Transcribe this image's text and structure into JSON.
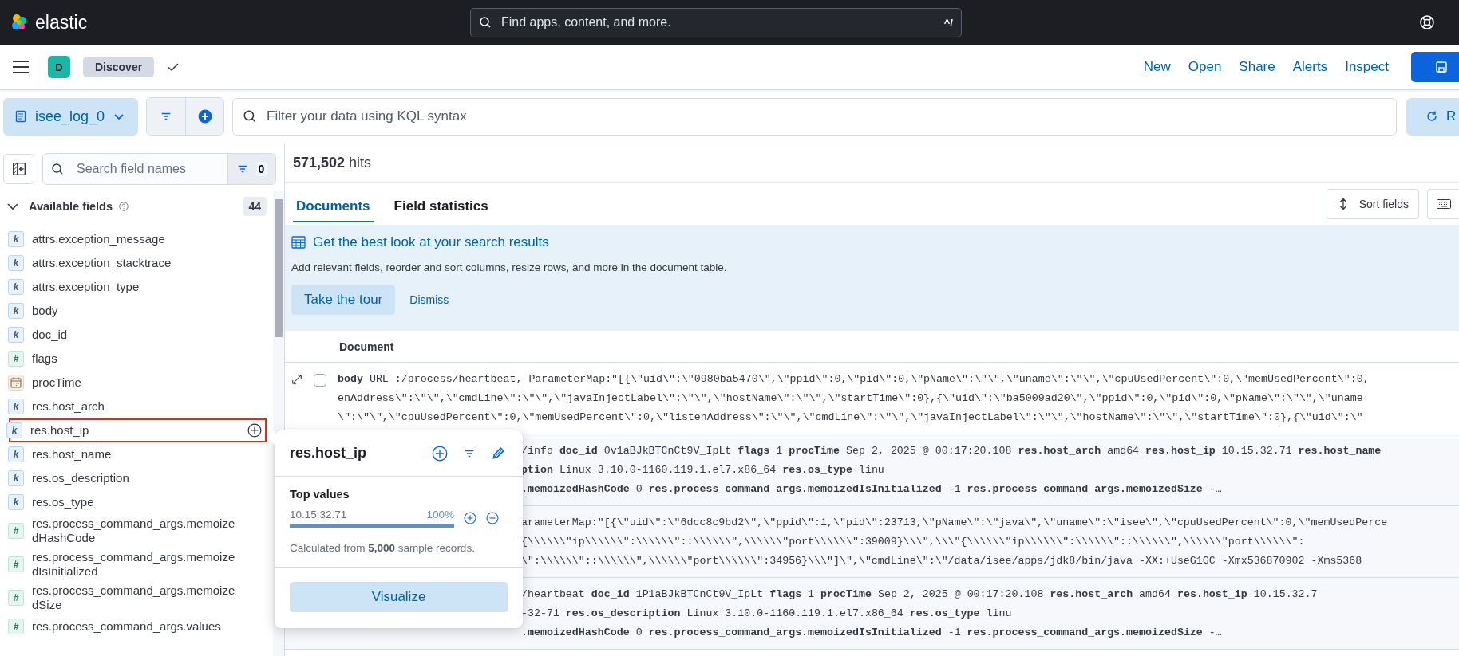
{
  "header": {
    "brand": "elastic",
    "search_placeholder": "Find apps, content, and more.",
    "shortcut": "^/"
  },
  "appbar": {
    "avatar": "D",
    "breadcrumb": "Discover",
    "links": [
      "New",
      "Open",
      "Share",
      "Alerts",
      "Inspect"
    ]
  },
  "querybar": {
    "data_view": "isee_log_0",
    "query_placeholder": "Filter your data using KQL syntax",
    "refresh_label": "R"
  },
  "sidebar": {
    "search_placeholder": "Search field names",
    "filter_count": "0",
    "section_title": "Available fields",
    "section_count": "44",
    "expanded": true,
    "fields": [
      {
        "name": "attrs.exception_message",
        "kind": "keyword",
        "token": "k",
        "selected": false
      },
      {
        "name": "attrs.exception_stacktrace",
        "kind": "keyword",
        "token": "k",
        "selected": false
      },
      {
        "name": "attrs.exception_type",
        "kind": "keyword",
        "token": "k",
        "selected": false
      },
      {
        "name": "body",
        "kind": "keyword",
        "token": "k",
        "selected": false
      },
      {
        "name": "doc_id",
        "kind": "keyword",
        "token": "k",
        "selected": false
      },
      {
        "name": "flags",
        "kind": "number",
        "token": "#",
        "selected": false
      },
      {
        "name": "procTime",
        "kind": "date",
        "selected": false
      },
      {
        "name": "res.host_arch",
        "kind": "keyword",
        "token": "k",
        "selected": false
      },
      {
        "name": "res.host_ip",
        "kind": "keyword",
        "token": "k",
        "selected": true
      },
      {
        "name": "res.host_name",
        "kind": "keyword",
        "token": "k",
        "selected": false
      },
      {
        "name": "res.os_description",
        "kind": "keyword",
        "token": "k",
        "selected": false
      },
      {
        "name": "res.os_type",
        "kind": "keyword",
        "token": "k",
        "selected": false
      },
      {
        "name": "res.process_command_args.memoizedHashCode",
        "kind": "number",
        "token": "#",
        "selected": false
      },
      {
        "name": "res.process_command_args.memoizedIsInitialized",
        "kind": "number",
        "token": "#",
        "selected": false
      },
      {
        "name": "res.process_command_args.memoizedSize",
        "kind": "number",
        "token": "#",
        "selected": false
      },
      {
        "name": "res.process_command_args.values",
        "kind": "number",
        "token": "#",
        "selected": false
      }
    ]
  },
  "results": {
    "hits": "**571,502** hits",
    "tabs": [
      {
        "label": "Documents",
        "selected": true
      },
      {
        "label": "Field statistics",
        "selected": false
      }
    ],
    "sort_button": "Sort fields",
    "callout": {
      "title": "Get the best look at your search results",
      "text": "Add relevant fields, reorder and sort columns, resize rows, and more in the document table.",
      "primary": "Take the tour",
      "secondary": "Dismiss"
    },
    "column": "Document",
    "rows": [
      {
        "kind": "full",
        "checked": false,
        "lines": [
          "**body** URL :/process/heartbeat, ParameterMap:\"[{\\\"uid\\\":\\\"0980ba5470\\\",\\\"ppid\\\":0,\\\"pid\\\":0,\\\"pName\\\":\\\"\\\",\\\"uname\\\":\\\"\\\",\\\"cpuUsedPercent\\\":0,\\\"memUsedPercent\\\":0,",
          "enAddress\\\":\\\"\\\",\\\"cmdLine\\\":\\\"\\\",\\\"javaInjectLabel\\\":\\\"\\\",\\\"hostName\\\":\\\"\\\",\\\"startTime\\\":0},{\\\"uid\\\":\\\"ba5009ad20\\\",\\\"ppid\\\":0,\\\"pid\\\":0,\\\"pName\\\":\\\"\\\",\\\"uname",
          "\\\":\\\"\\\",\\\"cpuUsedPercent\\\":0,\\\"memUsedPercent\\\":0,\\\"listenAddress\\\":\\\"\\\",\\\"cmdLine\\\":\\\"\\\",\\\"javaInjectLabel\\\":\\\"\\\",\\\"hostName\\\":\\\"\\\",\\\"startTime\\\":0},{\\\"uid\\\":\\\""
        ]
      },
      {
        "kind": "covered",
        "lines": [
          "/info **doc_id** 0v1aBJkBTCnCt9V_IpLt **flags** 1 **procTime** Sep 2, 2025 @ 00:17:20.108 **res.host_arch** amd64 **res.host_ip** 10.15.32.71 **res.host_name**",
          "**ption** Linux 3.10.0-1160.119.1.el7.x86_64 **res.os_type** linu",
          "**.memoizedHashCode** 0 **res.process_command_args.memoizedIsInitialized** -1 **res.process_command_args.memoizedSize** -…"
        ]
      },
      {
        "kind": "covered",
        "lines": [
          "arameterMap:\"[{\\\"uid\\\":\\\"6dcc8c9bd2\\\",\\\"ppid\\\":1,\\\"pid\\\":23713,\\\"pName\\\":\\\"java\\\",\\\"uname\\\":\\\"isee\\\",\\\"cpuUsedPercent\\\":0,\\\"memUsedPerce",
          "{\\\\\\\\\\\\\"ip\\\\\\\\\\\\\":\\\\\\\\\\\\\"::\\\\\\\\\\\\\",\\\\\\\\\\\\\"port\\\\\\\\\\\\\":39009}\\\\\\\",\\\\\\\"{\\\\\\\\\\\\\"ip\\\\\\\\\\\\\":\\\\\\\\\\\\\"::\\\\\\\\\\\\\",\\\\\\\\\\\\\"port\\\\\\\\\\\\\":",
          "\\\":\\\\\\\\\\\\\"::\\\\\\\\\\\\\",\\\\\\\\\\\\\"port\\\\\\\\\\\\\":34956}\\\\\\\"]\\\",\\\"cmdLine\\\":\\\"/data/isee/apps/jdk8/bin/java -XX:+UseG1GC -Xmx536870902 -Xms5368"
        ]
      },
      {
        "kind": "covered",
        "lines": [
          "/heartbeat **doc_id** 1P1aBJkBTCnCt9V_IpLt **flags** 1 **procTime** Sep 2, 2025 @ 00:17:20.108 **res.host_arch** amd64 **res.host_ip** 10.15.32.7",
          "-32-71 **res.os_description** Linux 3.10.0-1160.119.1.el7.x86_64 **res.os_type** linu",
          "**.memoizedHashCode** 0 **res.process_command_args.memoizedIsInitialized** -1 **res.process_command_args.memoizedSize** -…"
        ]
      }
    ]
  },
  "popover": {
    "title": "res.host_ip",
    "section": "Top values",
    "top_values": [
      {
        "value": "10.15.32.71",
        "percent": "100%",
        "level": 1.0
      }
    ],
    "note": "Calculated from **5,000** sample records.",
    "button": "Visualize"
  }
}
